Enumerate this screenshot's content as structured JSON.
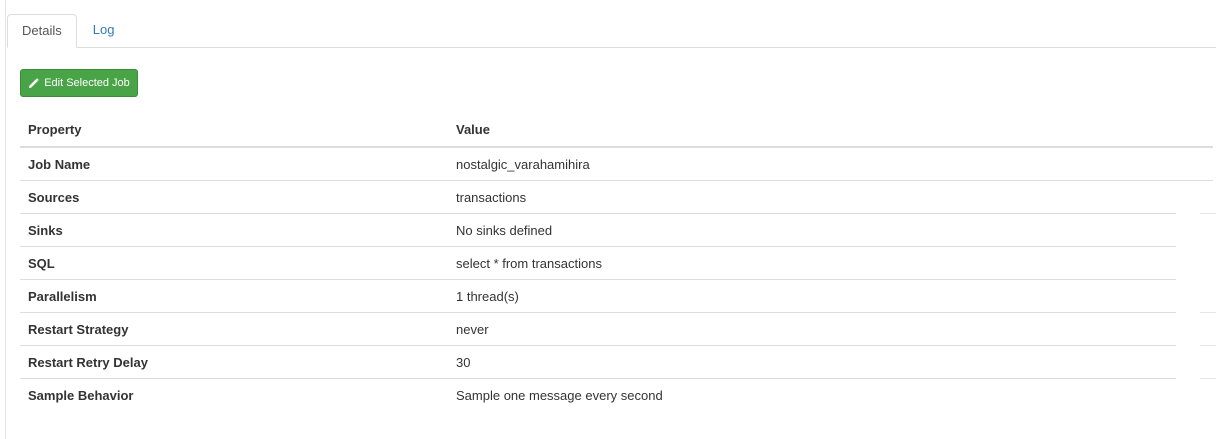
{
  "tabs": [
    {
      "label": "Details",
      "active": true
    },
    {
      "label": "Log",
      "active": false
    }
  ],
  "toolbar": {
    "edit_button_label": "Edit Selected Job",
    "edit_button_icon": "pencil-icon",
    "button_color": "#49a447"
  },
  "table": {
    "headers": {
      "property": "Property",
      "value": "Value"
    },
    "rows": [
      {
        "property": "Job Name",
        "value": "nostalgic_varahamihira"
      },
      {
        "property": "Sources",
        "value": "transactions"
      },
      {
        "property": "Sinks",
        "value": "No sinks defined"
      },
      {
        "property": "SQL",
        "value": "select * from transactions"
      },
      {
        "property": "Parallelism",
        "value": "1 thread(s)"
      },
      {
        "property": "Restart Strategy",
        "value": "never"
      },
      {
        "property": "Restart Retry Delay",
        "value": "30"
      },
      {
        "property": "Sample Behavior",
        "value": "Sample one message every second"
      }
    ]
  }
}
